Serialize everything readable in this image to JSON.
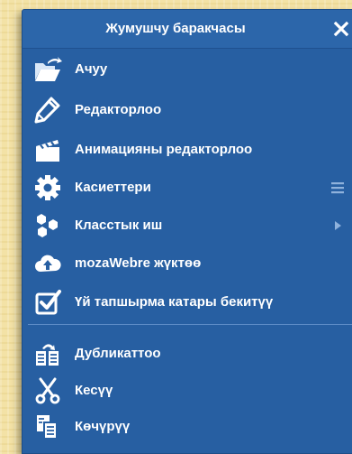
{
  "window": {
    "title": "Жумушчу баракчасы",
    "close_symbol": "✕"
  },
  "menu": {
    "items": [
      {
        "label": "Ачуу",
        "icon": "open-folder-icon"
      },
      {
        "label": "Редакторлоо",
        "icon": "pencil-icon"
      },
      {
        "label": "Анимацияны редакторлоо",
        "icon": "clapperboard-icon"
      },
      {
        "label": "Касиеттери",
        "icon": "gear-icon"
      },
      {
        "label": "Класстык иш",
        "icon": "hexagons-icon"
      },
      {
        "label": "mozaWebre жүктөө",
        "icon": "cloud-upload-icon"
      },
      {
        "label": "Үй тапшырма катары бекитүү",
        "icon": "checkbox-icon"
      },
      {
        "label": "Дубликаттоо",
        "icon": "duplicate-icon"
      },
      {
        "label": "Кесүү",
        "icon": "scissors-icon"
      },
      {
        "label": "Көчүрүү",
        "icon": "copy-icon"
      }
    ]
  }
}
